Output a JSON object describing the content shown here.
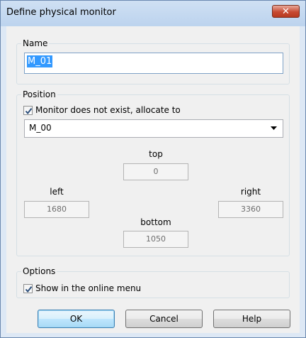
{
  "dialog": {
    "title": "Define physical monitor",
    "close_icon": "close-icon"
  },
  "name_group": {
    "label": "Name",
    "value": "M_01"
  },
  "position_group": {
    "label": "Position",
    "allocate_checkbox": {
      "label": "Monitor does not exist, allocate to",
      "checked": true
    },
    "allocate_select": {
      "value": "M_00"
    },
    "top": {
      "label": "top",
      "value": "0"
    },
    "left": {
      "label": "left",
      "value": "1680"
    },
    "right": {
      "label": "right",
      "value": "3360"
    },
    "bottom": {
      "label": "bottom",
      "value": "1050"
    }
  },
  "options_group": {
    "label": "Options",
    "online_menu_checkbox": {
      "label": "Show in the online menu",
      "checked": true
    }
  },
  "buttons": {
    "ok": "OK",
    "cancel": "Cancel",
    "help": "Help"
  }
}
